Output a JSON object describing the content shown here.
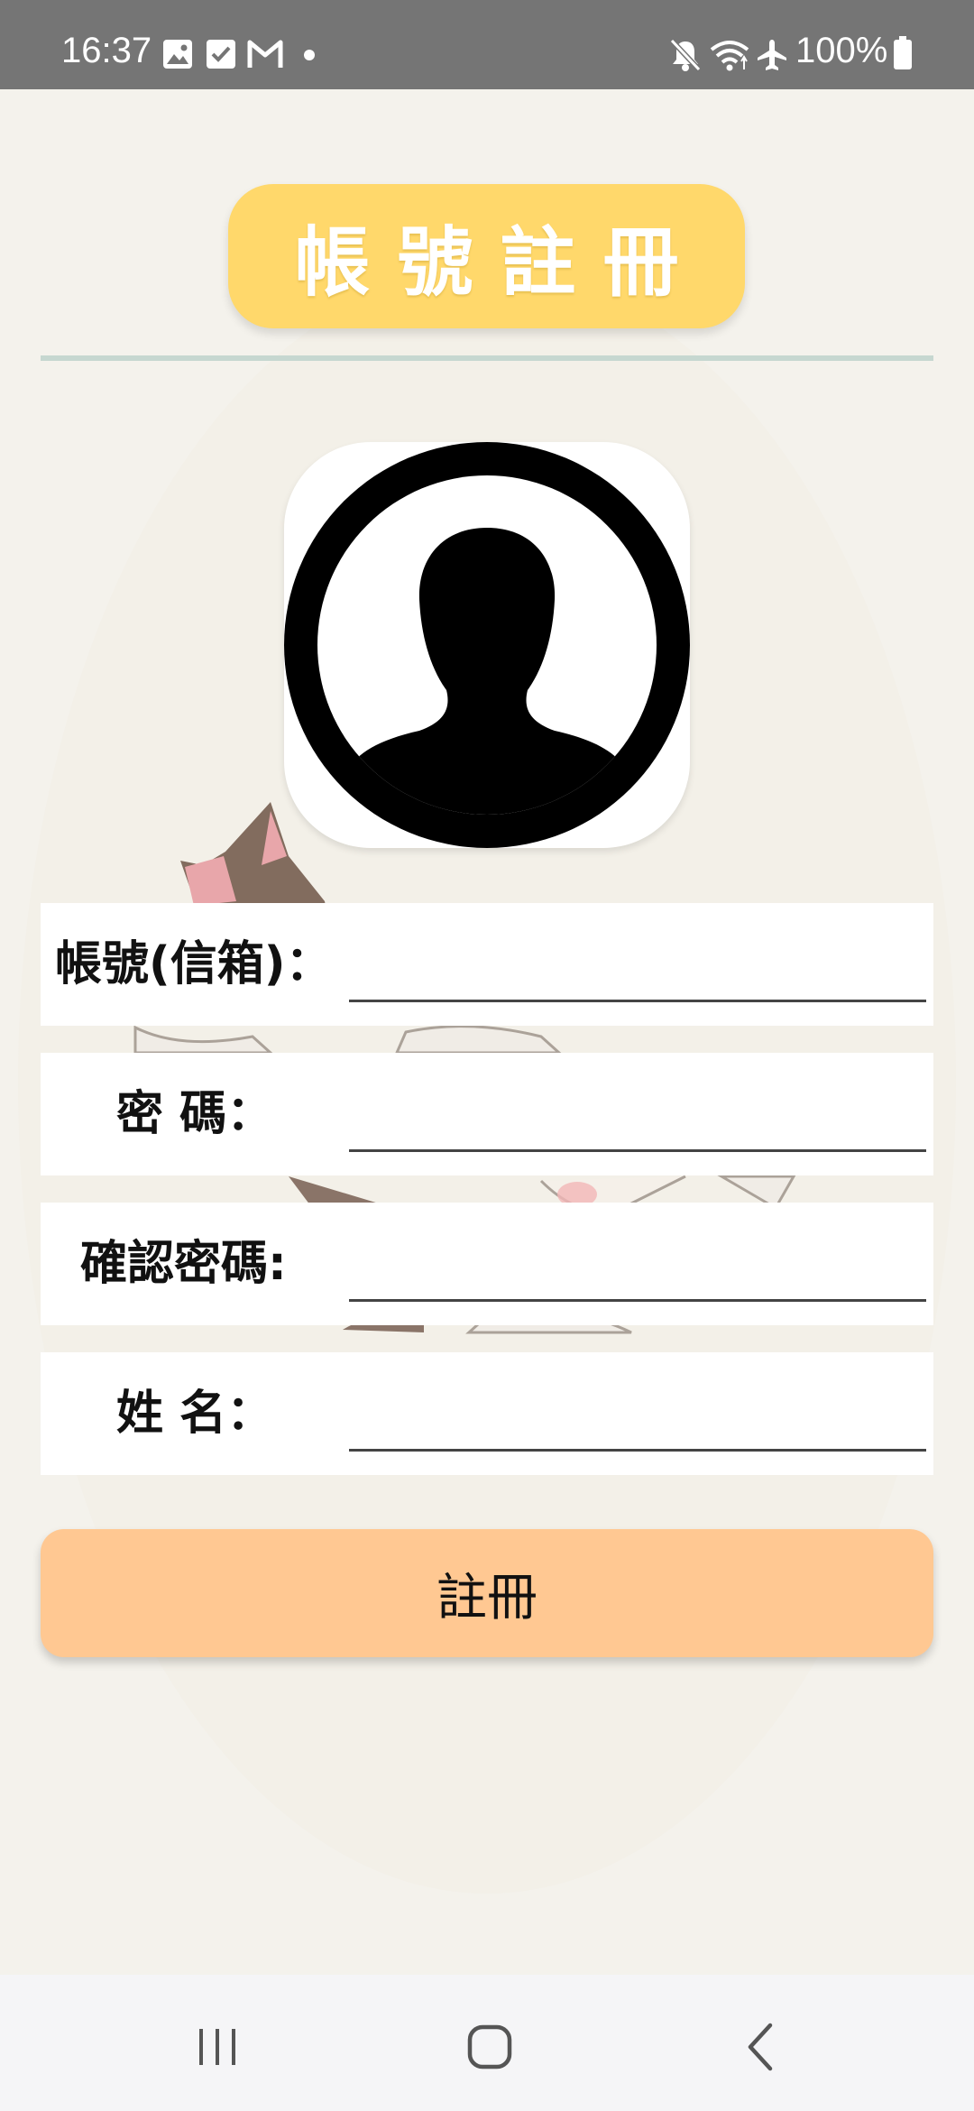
{
  "status_bar": {
    "time": "16:37",
    "battery": "100%",
    "left_icons": [
      "gallery-icon",
      "checkbox-icon",
      "gmail-icon",
      "dot-icon"
    ],
    "right_icons": [
      "mute-icon",
      "wifi-icon",
      "airplane-icon",
      "battery-icon"
    ]
  },
  "title": "帳號註冊",
  "form": {
    "account_label": "帳號(信箱)：",
    "password_label": "密 碼：",
    "confirm_label": "確認密碼:",
    "name_label": "姓 名：",
    "account_value": "",
    "password_value": "",
    "confirm_value": "",
    "name_value": ""
  },
  "submit_label": "註冊",
  "colors": {
    "title_pill": "#ffd86b",
    "divider": "#c6d7d0",
    "submit_button": "#ffc892",
    "status_bar": "#757575",
    "background": "#f4f2ec"
  },
  "nav": {
    "icons": [
      "recent-apps-icon",
      "home-icon",
      "back-icon"
    ]
  }
}
